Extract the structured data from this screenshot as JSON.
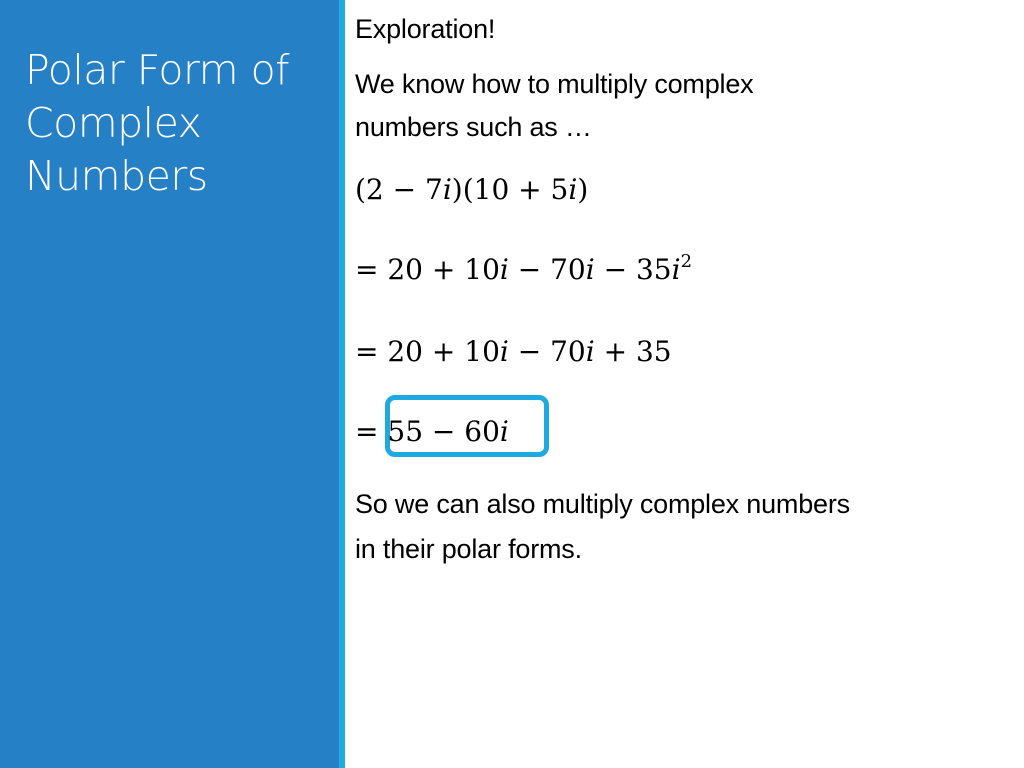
{
  "sidebar": {
    "title_lines": [
      "Polar Form of",
      "Complex",
      "Numbers"
    ],
    "colors": {
      "panel": "#2580c6",
      "stripe": "#1fa9e1"
    }
  },
  "content": {
    "heading": "Exploration!",
    "intro_line1": "We know how to multiply complex",
    "intro_line2": "numbers such as …",
    "expression": {
      "p1_open": "(2 − 7",
      "p1_i": "i",
      "p1_close": ")(10 + 5",
      "p1_i2": "i",
      "p1_end": ")"
    },
    "step1": {
      "a": "= 20 + 10",
      "b": "i",
      "c": " − 70",
      "d": "i",
      "e": " − 35",
      "f": "i",
      "sup": "2"
    },
    "step2": {
      "a": "= 20 + 10",
      "b": "i",
      "c": " − 70",
      "d": "i",
      "e": " + 35"
    },
    "step3": {
      "eq": "=",
      "a": "55 − 60",
      "b": "i"
    },
    "conclusion_line1": "So we can also multiply complex numbers",
    "conclusion_line2": "in their polar forms.",
    "highlight_color": "#1fa9e1"
  }
}
